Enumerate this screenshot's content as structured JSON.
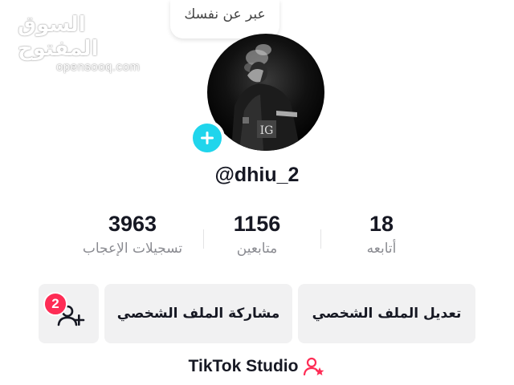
{
  "watermark": {
    "arabic": "السوق المفتوح",
    "latin": "opensooq.com"
  },
  "note": {
    "text": "عبر عن نفسك"
  },
  "profile": {
    "username": "@dhiu_2"
  },
  "stats": {
    "likes": {
      "value": "3963",
      "label": "تسجيلات الإعجاب"
    },
    "followers": {
      "value": "1156",
      "label": "متابعين"
    },
    "following": {
      "value": "18",
      "label": "أتابعه"
    }
  },
  "buttons": {
    "edit_profile": "تعديل الملف الشخصي",
    "share_profile": "مشاركة الملف الشخصي",
    "add_friends_badge": "2"
  },
  "studio": {
    "label": "TikTok Studio"
  },
  "colors": {
    "accent_cyan": "#20d5ec",
    "accent_red": "#fe2c55",
    "button_bg": "#f1f1f2",
    "label_gray": "#8a8b91"
  },
  "icons": [
    "plus-icon",
    "add-user-icon",
    "studio-icon"
  ]
}
